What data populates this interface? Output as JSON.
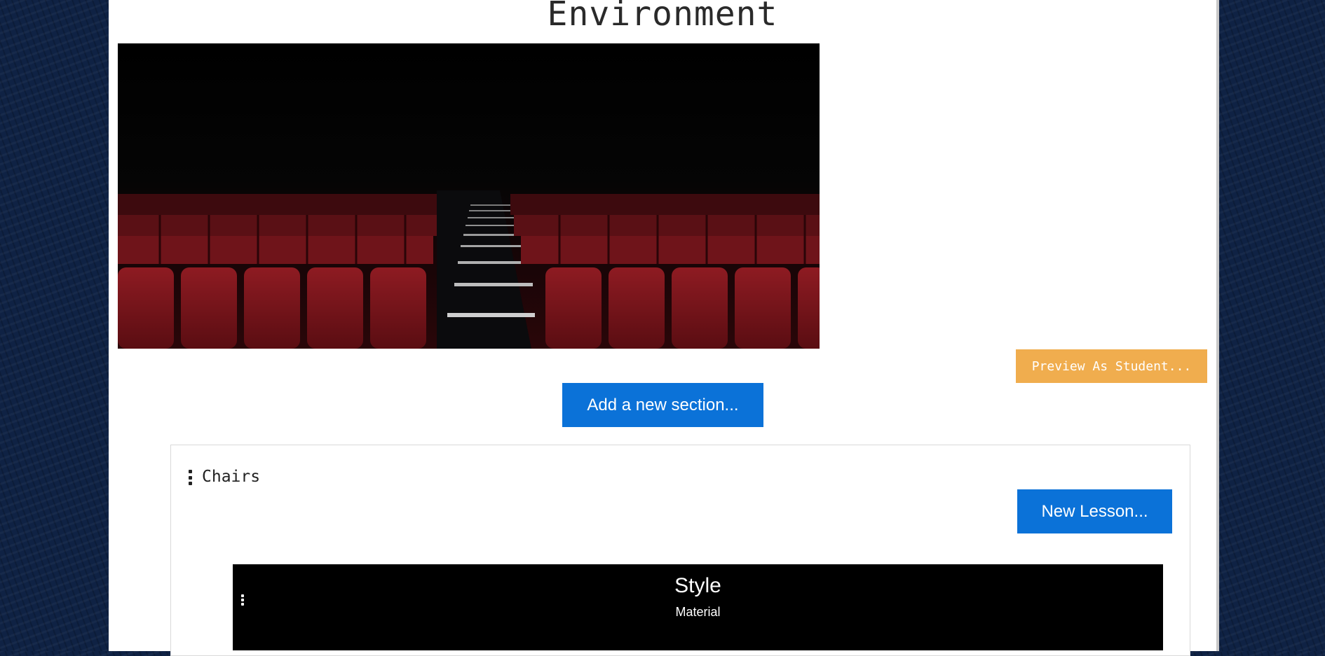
{
  "page": {
    "title": "Environment",
    "hero_image": "theater-seats-image"
  },
  "actions": {
    "preview_label": "Preview As Student...",
    "add_section_label": "Add a new section..."
  },
  "section": {
    "title": "Chairs",
    "new_lesson_label": "New Lesson...",
    "lessons": [
      {
        "title": "Style",
        "subtitle": "Material"
      }
    ]
  },
  "colors": {
    "primary_button": "#0b72d8",
    "warning_button": "#f0ad4e",
    "background": "#0f2244"
  }
}
